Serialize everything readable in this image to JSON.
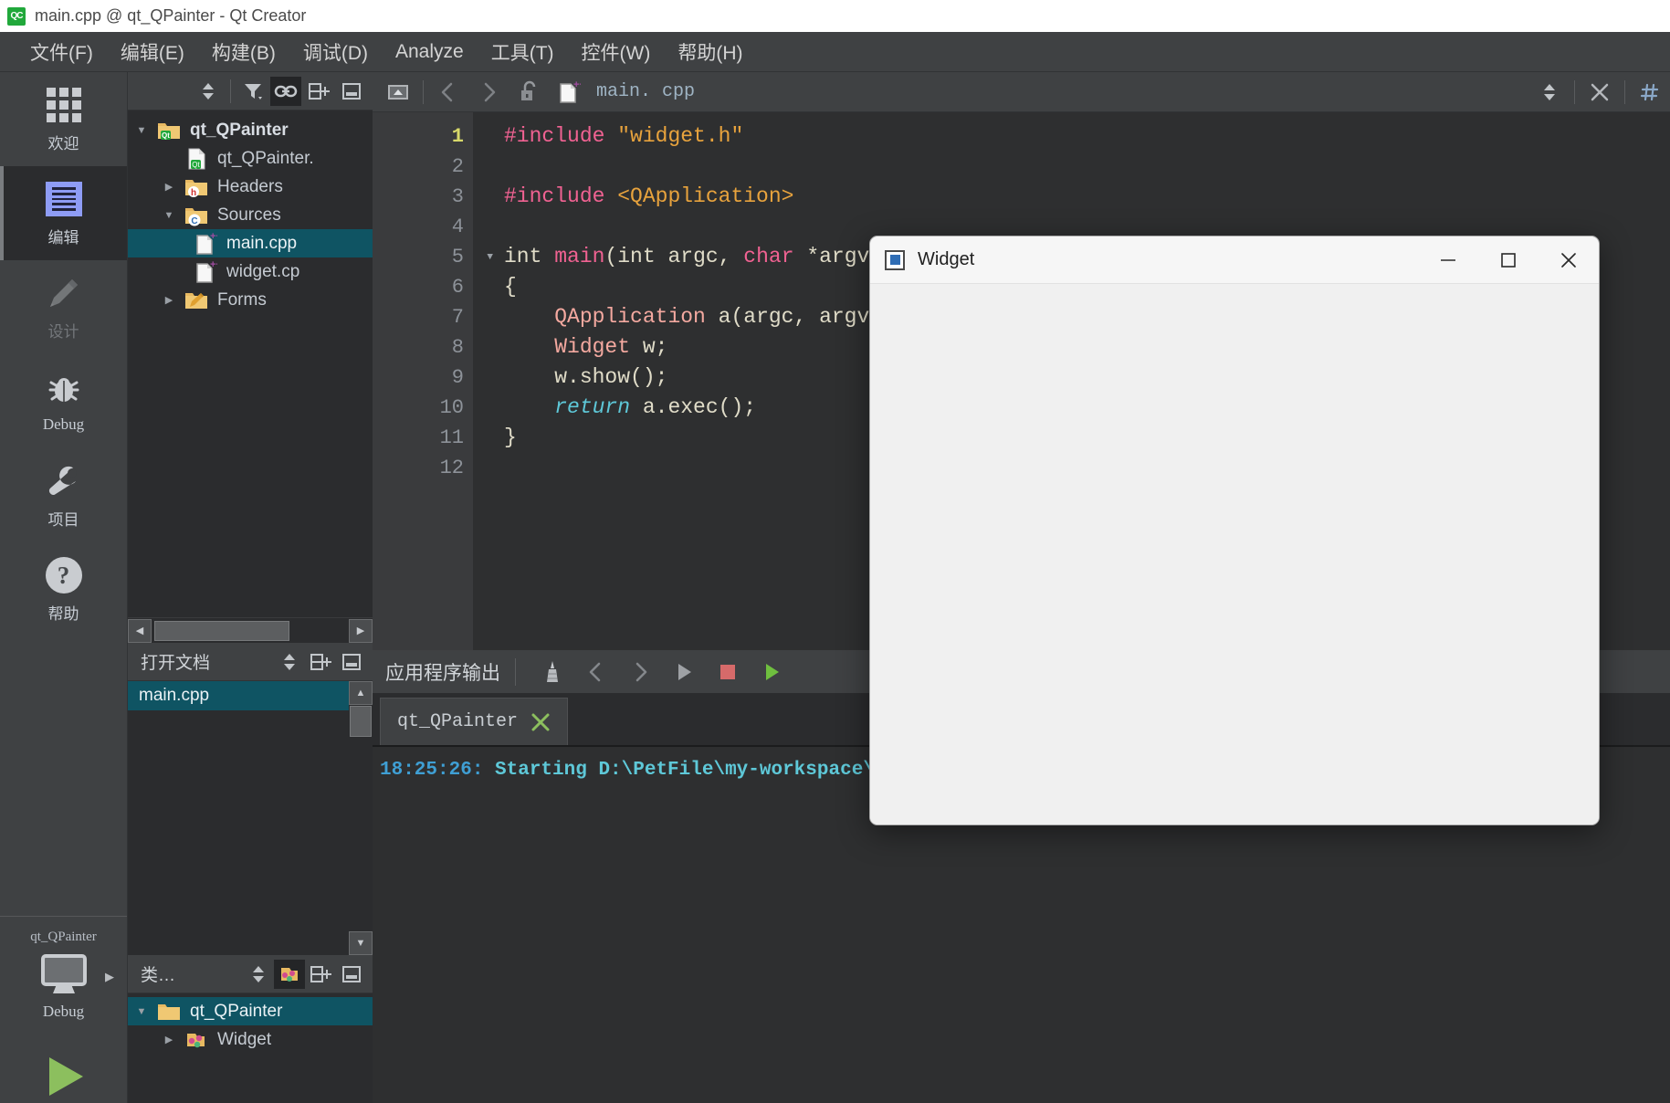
{
  "window": {
    "title": "main.cpp @ qt_QPainter - Qt Creator",
    "app_icon": "qt-creator-icon"
  },
  "menubar": {
    "items": [
      {
        "text": "文件(F)",
        "mnemonic": "F"
      },
      {
        "text": "编辑(E)",
        "mnemonic": "E"
      },
      {
        "text": "构建(B)",
        "mnemonic": "B"
      },
      {
        "text": "调试(D)",
        "mnemonic": "D"
      },
      {
        "text": "Analyze",
        "mnemonic": "A"
      },
      {
        "text": "工具(T)",
        "mnemonic": "T"
      },
      {
        "text": "控件(W)",
        "mnemonic": "W"
      },
      {
        "text": "帮助(H)",
        "mnemonic": "H"
      }
    ]
  },
  "modebar": {
    "items": [
      {
        "label": "欢迎",
        "icon": "grid-icon",
        "state": "normal"
      },
      {
        "label": "编辑",
        "icon": "edit-icon",
        "state": "active"
      },
      {
        "label": "设计",
        "icon": "pencil-icon",
        "state": "disabled"
      },
      {
        "label": "Debug",
        "icon": "bug-icon",
        "state": "normal"
      },
      {
        "label": "项目",
        "icon": "wrench-icon",
        "state": "normal"
      },
      {
        "label": "帮助",
        "icon": "question-icon",
        "state": "normal"
      }
    ],
    "kit": {
      "project_name": "qt_QPainter",
      "build_config": "Debug",
      "icon": "monitor-icon",
      "expand_arrow": "▶"
    },
    "run_button": "run-icon"
  },
  "project_panel": {
    "toolbar": {
      "buttons": [
        {
          "name": "filter-view-selector",
          "icon": "updown-arrows-icon"
        },
        {
          "name": "filter-tree",
          "icon": "funnel-icon"
        },
        {
          "name": "sync-with-editor",
          "icon": "link-icon",
          "selected": true
        },
        {
          "name": "split-pane",
          "icon": "split-icon"
        },
        {
          "name": "close-pane",
          "icon": "minimize-icon"
        }
      ]
    },
    "tree": [
      {
        "label": "qt_QPainter",
        "icon": "qt-project-folder-icon",
        "depth": 0,
        "twist": "expanded",
        "bold": true,
        "selected": false
      },
      {
        "label": "qt_QPainter.",
        "icon": "qt-pro-file-icon",
        "depth": 1,
        "twist": "none",
        "bold": false,
        "selected": false
      },
      {
        "label": "Headers",
        "icon": "headers-folder-icon",
        "depth": 1,
        "twist": "collapsed",
        "bold": false,
        "selected": false
      },
      {
        "label": "Sources",
        "icon": "sources-folder-icon",
        "depth": 1,
        "twist": "expanded",
        "bold": false,
        "selected": false
      },
      {
        "label": "main.cpp",
        "icon": "cpp-file-icon",
        "depth": 2,
        "twist": "none",
        "bold": false,
        "selected": true
      },
      {
        "label": "widget.cp",
        "icon": "cpp-file-icon",
        "depth": 2,
        "twist": "none",
        "bold": false,
        "selected": false
      },
      {
        "label": "Forms",
        "icon": "forms-folder-icon",
        "depth": 1,
        "twist": "collapsed",
        "bold": false,
        "selected": false
      }
    ]
  },
  "open_documents": {
    "title": "打开文档",
    "toolbar_buttons": [
      {
        "name": "doc-view-selector",
        "icon": "updown-arrows-icon"
      },
      {
        "name": "split-pane",
        "icon": "split-icon"
      },
      {
        "name": "close-pane",
        "icon": "minimize-icon"
      }
    ],
    "items": [
      {
        "label": "main.cpp",
        "selected": true
      }
    ]
  },
  "class_panel": {
    "title": "类…",
    "toolbar_buttons": [
      {
        "name": "class-view-selector",
        "icon": "updown-arrows-icon"
      },
      {
        "name": "sync-class-view",
        "icon": "class-sync-icon",
        "selected": true
      },
      {
        "name": "split-pane",
        "icon": "split-icon"
      },
      {
        "name": "close-pane",
        "icon": "minimize-icon"
      }
    ],
    "tree": [
      {
        "label": "qt_QPainter",
        "icon": "folder-icon",
        "depth": 0,
        "twist": "expanded",
        "selected": true
      },
      {
        "label": "Widget",
        "icon": "class-icon",
        "depth": 1,
        "twist": "collapsed",
        "selected": false
      }
    ]
  },
  "editor": {
    "toolbar": {
      "back_icon": "chevron-left-icon",
      "forward_icon": "chevron-right-icon",
      "lock_icon": "unlock-icon",
      "file_icon": "cpp-file-icon",
      "filename": "main. cpp",
      "file_selector_icon": "updown-arrows-icon",
      "close_icon": "close-x-icon",
      "split_icon": "hash-icon",
      "up_icon": "collapse-up-icon"
    },
    "current_line": 1,
    "lines": [
      {
        "n": 1,
        "fold": false,
        "tokens": [
          {
            "t": "#include",
            "c": "k-pre"
          },
          {
            "t": " ",
            "c": "k-plain"
          },
          {
            "t": "\"widget.h\"",
            "c": "k-str"
          }
        ]
      },
      {
        "n": 2,
        "fold": false,
        "tokens": []
      },
      {
        "n": 3,
        "fold": false,
        "tokens": [
          {
            "t": "#include",
            "c": "k-pre"
          },
          {
            "t": " ",
            "c": "k-plain"
          },
          {
            "t": "<QApplication>",
            "c": "k-str"
          }
        ]
      },
      {
        "n": 4,
        "fold": false,
        "tokens": []
      },
      {
        "n": 5,
        "fold": true,
        "tokens": [
          {
            "t": "int ",
            "c": "k-plain"
          },
          {
            "t": "main",
            "c": "k-fn"
          },
          {
            "t": "(",
            "c": "k-plain"
          },
          {
            "t": "int ",
            "c": "k-plain"
          },
          {
            "t": "argc",
            "c": "k-var"
          },
          {
            "t": ", ",
            "c": "k-plain"
          },
          {
            "t": "char",
            "c": "k-kw"
          },
          {
            "t": " *argv[])",
            "c": "k-plain"
          }
        ]
      },
      {
        "n": 6,
        "fold": false,
        "tokens": [
          {
            "t": "{",
            "c": "k-brace"
          }
        ]
      },
      {
        "n": 7,
        "fold": false,
        "tokens": [
          {
            "t": "    ",
            "c": "k-plain"
          },
          {
            "t": "QApplication",
            "c": "k-type"
          },
          {
            "t": " a(argc, argv);",
            "c": "k-plain"
          }
        ]
      },
      {
        "n": 8,
        "fold": false,
        "tokens": [
          {
            "t": "    ",
            "c": "k-plain"
          },
          {
            "t": "Widget",
            "c": "k-type"
          },
          {
            "t": " w;",
            "c": "k-plain"
          }
        ]
      },
      {
        "n": 9,
        "fold": false,
        "tokens": [
          {
            "t": "    w.show();",
            "c": "k-plain"
          }
        ]
      },
      {
        "n": 10,
        "fold": false,
        "tokens": [
          {
            "t": "    ",
            "c": "k-plain"
          },
          {
            "t": "return",
            "c": "k-ret"
          },
          {
            "t": " a.exec();",
            "c": "k-plain"
          }
        ]
      },
      {
        "n": 11,
        "fold": false,
        "tokens": [
          {
            "t": "}",
            "c": "k-brace"
          }
        ]
      },
      {
        "n": 12,
        "fold": false,
        "tokens": []
      }
    ]
  },
  "output_pane": {
    "title": "应用程序输出",
    "buttons": [
      {
        "name": "output-settings",
        "icon": "tower-icon"
      },
      {
        "name": "prev-item",
        "icon": "chevron-left-icon"
      },
      {
        "name": "next-item",
        "icon": "chevron-right-icon"
      },
      {
        "name": "run-app",
        "icon": "play-icon"
      },
      {
        "name": "stop-app",
        "icon": "stop-icon"
      },
      {
        "name": "restart-app",
        "icon": "play-green-icon"
      }
    ],
    "tabs": [
      {
        "label": "qt_QPainter",
        "active": true,
        "close_icon": "close-x-icon"
      }
    ],
    "lines": [
      {
        "time": "18:25:26:",
        "text": " Starting D:\\PetFile\\my-workspace\\qt\\build-qt_QPainter-Desktop_Qt_5_14_2_MinGW_32_bit-Debu"
      }
    ]
  },
  "widget_window": {
    "title": "Widget",
    "icon": "widget-app-icon",
    "controls": [
      {
        "name": "minimize-button",
        "icon": "minimize-icon"
      },
      {
        "name": "maximize-button",
        "icon": "maximize-icon"
      },
      {
        "name": "close-button",
        "icon": "close-x-icon"
      }
    ]
  },
  "colors": {
    "accent_selection": "#0f5463",
    "titlebar_bg": "#ffffff",
    "chrome_bg": "#3f4143",
    "panel_bg": "#2b2c2e",
    "editor_bg": "#2e2f30",
    "run_green": "#8cbf5e",
    "stop_red": "#d66a6a",
    "edit_icon_blue": "#8e9cf5"
  }
}
